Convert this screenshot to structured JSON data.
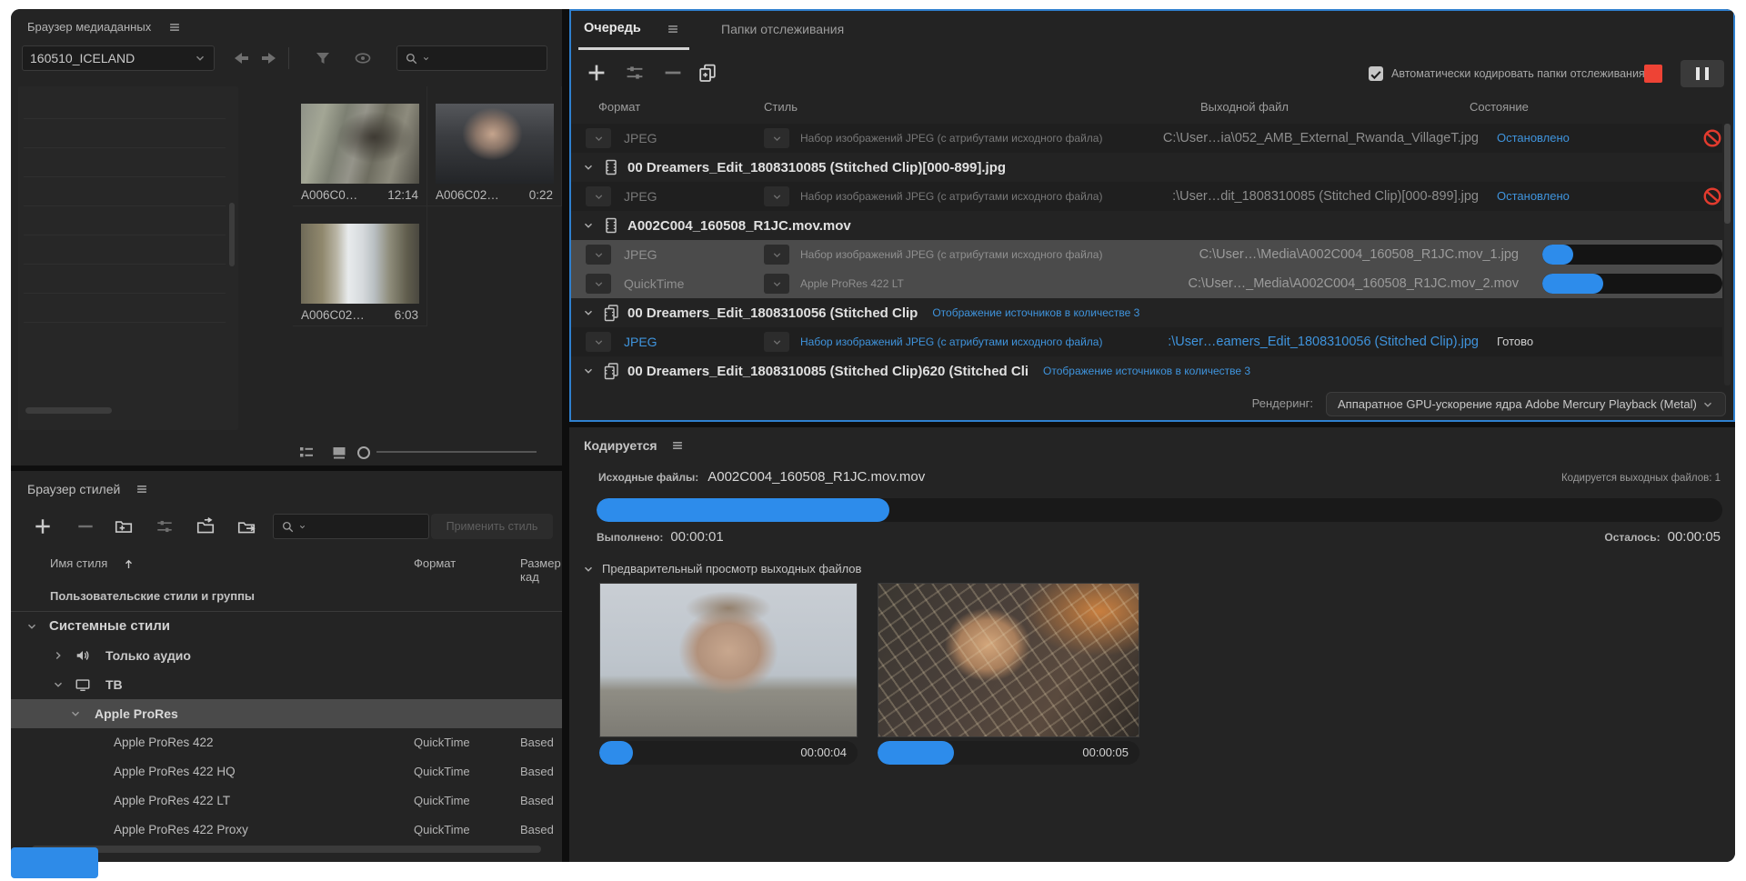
{
  "colors": {
    "accent": "#2d8ceb",
    "accent_text": "#3f94dd",
    "stop_red": "#ee4335",
    "selected_row": "#4b4b4b",
    "queue_border": "#2f80cf"
  },
  "media_browser": {
    "title": "Браузер медиаданных",
    "folder": "160510_ICELAND",
    "clips": [
      {
        "name": "A006C0…",
        "duration": "12:14"
      },
      {
        "name": "A006C02…",
        "duration": "0:22"
      },
      {
        "name": "A006C02…",
        "duration": "6:03"
      }
    ]
  },
  "preset_browser": {
    "title": "Браузер стилей",
    "apply_button": "Применить стиль",
    "columns": {
      "name": "Имя стиля",
      "format": "Формат",
      "size": "Размер кад"
    },
    "rows": [
      {
        "label": "Пользовательские стили и группы"
      },
      {
        "label": "Системные стили"
      },
      {
        "label": "Только аудио",
        "icon": "audio"
      },
      {
        "label": "ТВ",
        "icon": "tv"
      },
      {
        "label": "Apple ProRes",
        "selected": true
      },
      {
        "label": "Apple ProRes 422",
        "format": "QuickTime",
        "size": "Based"
      },
      {
        "label": "Apple ProRes 422 HQ",
        "format": "QuickTime",
        "size": "Based"
      },
      {
        "label": "Apple ProRes 422 LT",
        "format": "QuickTime",
        "size": "Based"
      },
      {
        "label": "Apple ProRes 422 Proxy",
        "format": "QuickTime",
        "size": "Based"
      }
    ]
  },
  "queue": {
    "tab_queue": "Очередь",
    "tab_watch": "Папки отслеживания",
    "auto_encode_label": "Автоматически кодировать папки отслеживания",
    "auto_encode_checked": true,
    "columns": {
      "format": "Формат",
      "style": "Стиль",
      "output": "Выходной файл",
      "status": "Состояние"
    },
    "rows": [
      {
        "type": "output",
        "state": "stopped",
        "format": "JPEG",
        "style": "Набор изображений JPEG (с атрибутами исходного файла)",
        "output": "C:\\User…ia\\052_AMB_External_Rwanda_VillageT.jpg",
        "status": "Остановлено"
      },
      {
        "type": "group",
        "icon": "clip",
        "name": "00 Dreamers_Edit_1808310085 (Stitched Clip)[000-899].jpg"
      },
      {
        "type": "output",
        "state": "stopped",
        "format": "JPEG",
        "style": "Набор изображений JPEG (с атрибутами исходного файла)",
        "output": ":\\User…dit_1808310085 (Stitched Clip)[000-899].jpg",
        "status": "Остановлено"
      },
      {
        "type": "group",
        "icon": "clip",
        "name": "A002C004_160508_R1JC.mov.mov"
      },
      {
        "type": "output",
        "state": "encoding",
        "format": "JPEG",
        "style": "Набор изображений JPEG (с атрибутами исходного файла)",
        "output": "C:\\User…\\Media\\A002C004_160508_R1JC.mov_1.jpg",
        "progress": 17
      },
      {
        "type": "output",
        "state": "encoding",
        "format": "QuickTime",
        "style": "Apple ProRes 422 LT",
        "output": "C:\\User…_Media\\A002C004_160508_R1JC.mov_2.mov",
        "progress": 34
      },
      {
        "type": "group",
        "icon": "clips",
        "name": "00 Dreamers_Edit_1808310056 (Stitched Clip",
        "link": "Отображение источников в количестве 3"
      },
      {
        "type": "output",
        "state": "done",
        "format": "JPEG",
        "style": "Набор изображений JPEG (с атрибутами исходного файла)",
        "output": ":\\User…eamers_Edit_1808310056 (Stitched Clip).jpg",
        "status": "Готово"
      },
      {
        "type": "group",
        "icon": "clips",
        "name": "00 Dreamers_Edit_1808310085 (Stitched Clip)620 (Stitched Cli",
        "link": "Отображение источников в количестве 3"
      }
    ],
    "render_label": "Рендеринг:",
    "render_value": "Аппаратное GPU-ускорение ядра Adobe Mercury Playback (Metal)"
  },
  "encoding": {
    "title": "Кодируется",
    "source_label": "Исходные файлы:",
    "source_value": "A002C004_160508_R1JC.mov.mov",
    "outputs_count": "Кодируется выходных файлов: 1",
    "elapsed_label": "Выполнено:",
    "elapsed_value": "00:00:01",
    "remaining_label": "Осталось:",
    "remaining_value": "00:00:05",
    "progress": 26,
    "preview_title": "Предварительный просмотр выходных файлов",
    "previews": [
      {
        "time": "00:00:04",
        "progress": 13
      },
      {
        "time": "00:00:05",
        "progress": 29
      }
    ]
  }
}
